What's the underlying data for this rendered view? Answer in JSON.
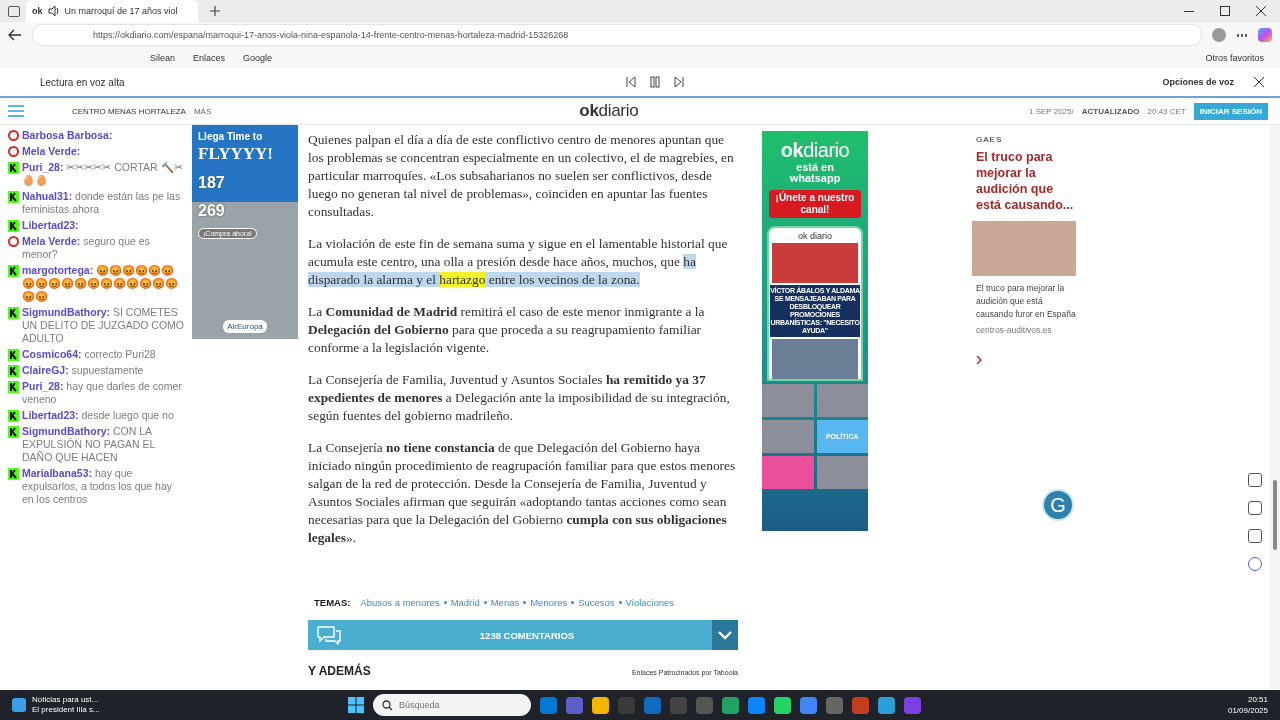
{
  "browser": {
    "favicon": "ok",
    "tab_title": "Un marroquí de 17 años viol",
    "url": "https://okdiario.com/espana/marroqui-17-anos-viola-nina-espanola-14-frente-centro-menas-hortaleza-madrid-15326268",
    "bookmarks": [
      "Silean",
      "Enlaces",
      "Google"
    ],
    "other_bookmarks": "Otros favoritos"
  },
  "read_aloud": {
    "label": "Lectura en voz alta",
    "options": "Opciones de voz"
  },
  "site_header": {
    "tag": "CENTRO MENAS HORTALEZA",
    "more": "MÁS",
    "logo": "**ok**diario",
    "date": "1 SEP 2025/",
    "updated_label": "ACTUALIZADO",
    "updated_time": "20:43 CET",
    "login": "INICIAR SESIÓN"
  },
  "left_ad": {
    "headline_small": "Llega Time to",
    "headline": "FLYYYY!",
    "price_1": "187",
    "price_2": "269",
    "cta": "¡Compra ahora!",
    "brand": "AirEuropa"
  },
  "article": {
    "paragraphs": [
      [
        {
          "text": "Quienes palpan el día a día de este conflictivo centro de menores apuntan que los problemas se concentran especialmente en un colectivo, el de magrebíes, en particular marroquíes. «Los subsaharianos no suelen ser conflictivos, desde luego no generan tal nivel de problemas», coinciden en apuntar las fuentes consultadas.",
          "kind": "plain"
        }
      ],
      [
        {
          "text": "La violación de este fin de semana suma y sigue en el lamentable historial que acumula este centro, una olla a presión desde hace años, muchos, que ",
          "kind": "plain"
        },
        {
          "text": "ha disparado la alarma y el ",
          "kind": "selection"
        },
        {
          "text": "hartazgo",
          "kind": "match"
        },
        {
          "text": " entre los vecinos de la zona.",
          "kind": "selection"
        }
      ],
      [
        {
          "text": "La **Comunidad de Madrid** remitirá el caso de este menor inmigrante a la **Delegación del Gobierno** para que proceda a su reagrupamiento familiar conforme a la legislación vigente.",
          "kind": "plain"
        }
      ],
      [
        {
          "text": "La Consejería de Familia, Juventud y Asuntos Sociales **ha remitido ya 37 expedientes de menores** a Delegación ante la imposibilidad de su integración, según fuentes del gobierno madrileño.",
          "kind": "plain"
        }
      ],
      [
        {
          "text": "La Consejería **no tiene constancia** de que Delegación del Gobierno haya iniciado ningún procedimiento de reagrupación familiar para que estos menores salgan de la red de protección. Desde la Consejería de Familia, Juventud y Asuntos Sociales afirman que seguirán «adoptando tantas acciones como sean necesarias para que la Delegación del Gobierno **cumpla con sus obligaciones legales**».",
          "kind": "plain"
        }
      ]
    ],
    "topics_label": "TEMAS:",
    "topics": [
      "Abusos a menores",
      "Madrid",
      "Menas",
      "Menores",
      "Sucesos",
      "Violaciones"
    ],
    "comments": "1238 COMENTARIOS",
    "more_heading": "Y ADEMÁS",
    "sponsored": "Enlaces Patrocinados por Taboola"
  },
  "middle_ad": {
    "logo": "**ok**diario",
    "line": "está en whatsapp",
    "cta": "¡Únete a nuestro canal!",
    "phone_logo": "ok diario",
    "phone_headline": "VÍCTOR ÁBALOS Y ALDAMA SE MENSAJEABAN PARA DESBLOQUEAR PROMOCIONES URBANÍSTICAS: \"NECESITO AYUDA\"",
    "section": "POLÍTICA"
  },
  "floating_button": "G",
  "sponsored_card": {
    "source": "GAES",
    "title": "El truco para mejorar la audición que está causando...",
    "description": "El truco para mejorar la audición que está causando furor en España",
    "domain": "centros-auditivos.es"
  },
  "chat": [
    {
      "kind": "youtube",
      "user": "Barbosa Barbosa:"
    },
    {
      "kind": "youtube",
      "user": "Mela Verde:"
    },
    {
      "kind": "kick",
      "user": "Puri_28:",
      "message": "✂✂✂✂✂ CORTAR 🔨✂🥚🥚"
    },
    {
      "kind": "kick",
      "user": "Nahual31:",
      "message": "donde están las pe las feministas ahora"
    },
    {
      "kind": "kick",
      "user": "Libertad23:"
    },
    {
      "kind": "youtube",
      "user": "Mela Verde:",
      "message": "seguro que es menor?"
    },
    {
      "kind": "kick",
      "user": "margotortega:",
      "message": "😡😡😡😡😡😡😡😡😡😡😡😡😡😡😡😡😡😡😡😡"
    },
    {
      "kind": "kick",
      "user": "SigmundBathory:",
      "message": "SI COMETES UN DELITO DE JUZGADO COMO ADULTO"
    },
    {
      "kind": "kick",
      "user": "Cosmico64:",
      "message": "correcto Puri28"
    },
    {
      "kind": "kick",
      "user": "ClaireGJ:",
      "message": "supuestamente"
    },
    {
      "kind": "kick",
      "user": "Puri_28:",
      "message": "hay que darles de comer veneno"
    },
    {
      "kind": "kick",
      "user": "Libertad23:",
      "message": "desde luego que no"
    },
    {
      "kind": "kick",
      "user": "SigmundBathory:",
      "message": "CON LA EXPULSIÓN NO PAGAN EL DAÑO QUE HACEN"
    },
    {
      "kind": "kick",
      "user": "MariaIbana53:",
      "message": "hay que expulsarlos, a todos los que hay en los centros"
    }
  ],
  "taskbar": {
    "news_title": "Noticias para ust...",
    "news_subtitle": "El president Illa s...",
    "search_placeholder": "Búsqueda",
    "time": "20:51",
    "date": "01/09/2025"
  }
}
